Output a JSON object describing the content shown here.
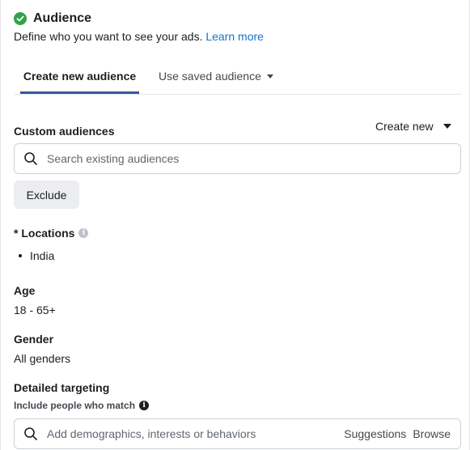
{
  "header": {
    "title": "Audience",
    "subtitle": "Define who you want to see your ads.",
    "learn_more": "Learn more",
    "status_color": "#31a24c"
  },
  "tabs": [
    {
      "label": "Create new audience",
      "active": true
    },
    {
      "label": "Use saved audience",
      "active": false
    }
  ],
  "custom_audiences": {
    "label": "Custom audiences",
    "create_new": "Create new",
    "search_placeholder": "Search existing audiences",
    "exclude_label": "Exclude"
  },
  "locations": {
    "label": "* Locations",
    "items": [
      "India"
    ]
  },
  "age": {
    "label": "Age",
    "value": "18 - 65+"
  },
  "gender": {
    "label": "Gender",
    "value": "All genders"
  },
  "detailed_targeting": {
    "label": "Detailed targeting",
    "sublabel": "Include people who match",
    "search_placeholder": "Add demographics, interests or behaviors",
    "suggestions": "Suggestions",
    "browse": "Browse"
  },
  "colors": {
    "accent": "#385898",
    "link": "#1a73c7"
  }
}
